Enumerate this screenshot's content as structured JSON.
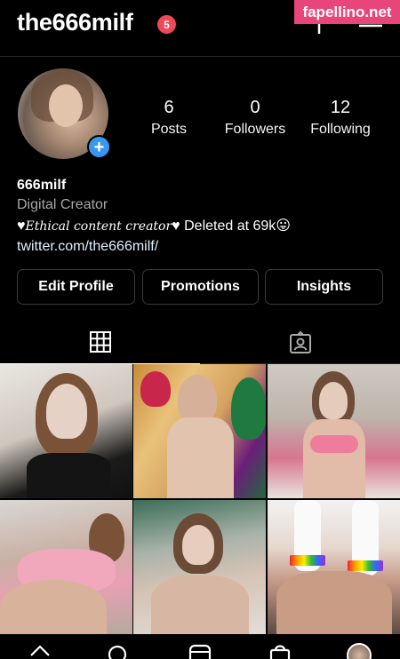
{
  "watermark": "fapellino.net",
  "header": {
    "username": "the666milf",
    "notification_count": "5",
    "icons": [
      "plus-icon",
      "menu-icon"
    ]
  },
  "profile": {
    "stats": [
      {
        "value": "6",
        "label": "Posts"
      },
      {
        "value": "0",
        "label": "Followers"
      },
      {
        "value": "12",
        "label": "Following"
      }
    ],
    "name": "666milf",
    "category": "Digital Creator",
    "bio_heart_left": "♥",
    "bio_script": "Ethical content creator",
    "bio_rest": "♥ Deleted at 69k😛",
    "link": "twitter.com/the666milf/"
  },
  "buttons": {
    "edit_profile": "Edit Profile",
    "promotions": "Promotions",
    "insights": "Insights"
  },
  "tabs": [
    "grid-icon",
    "tagged-icon"
  ],
  "posts_count_visible": 6,
  "bottom_nav": [
    "home-icon",
    "search-icon",
    "reels-icon",
    "shop-icon",
    "profile-avatar"
  ],
  "colors": {
    "background": "#000000",
    "badge": "#ed4956",
    "accent_blue": "#3897f0",
    "watermark_bg": "#e8457a"
  }
}
